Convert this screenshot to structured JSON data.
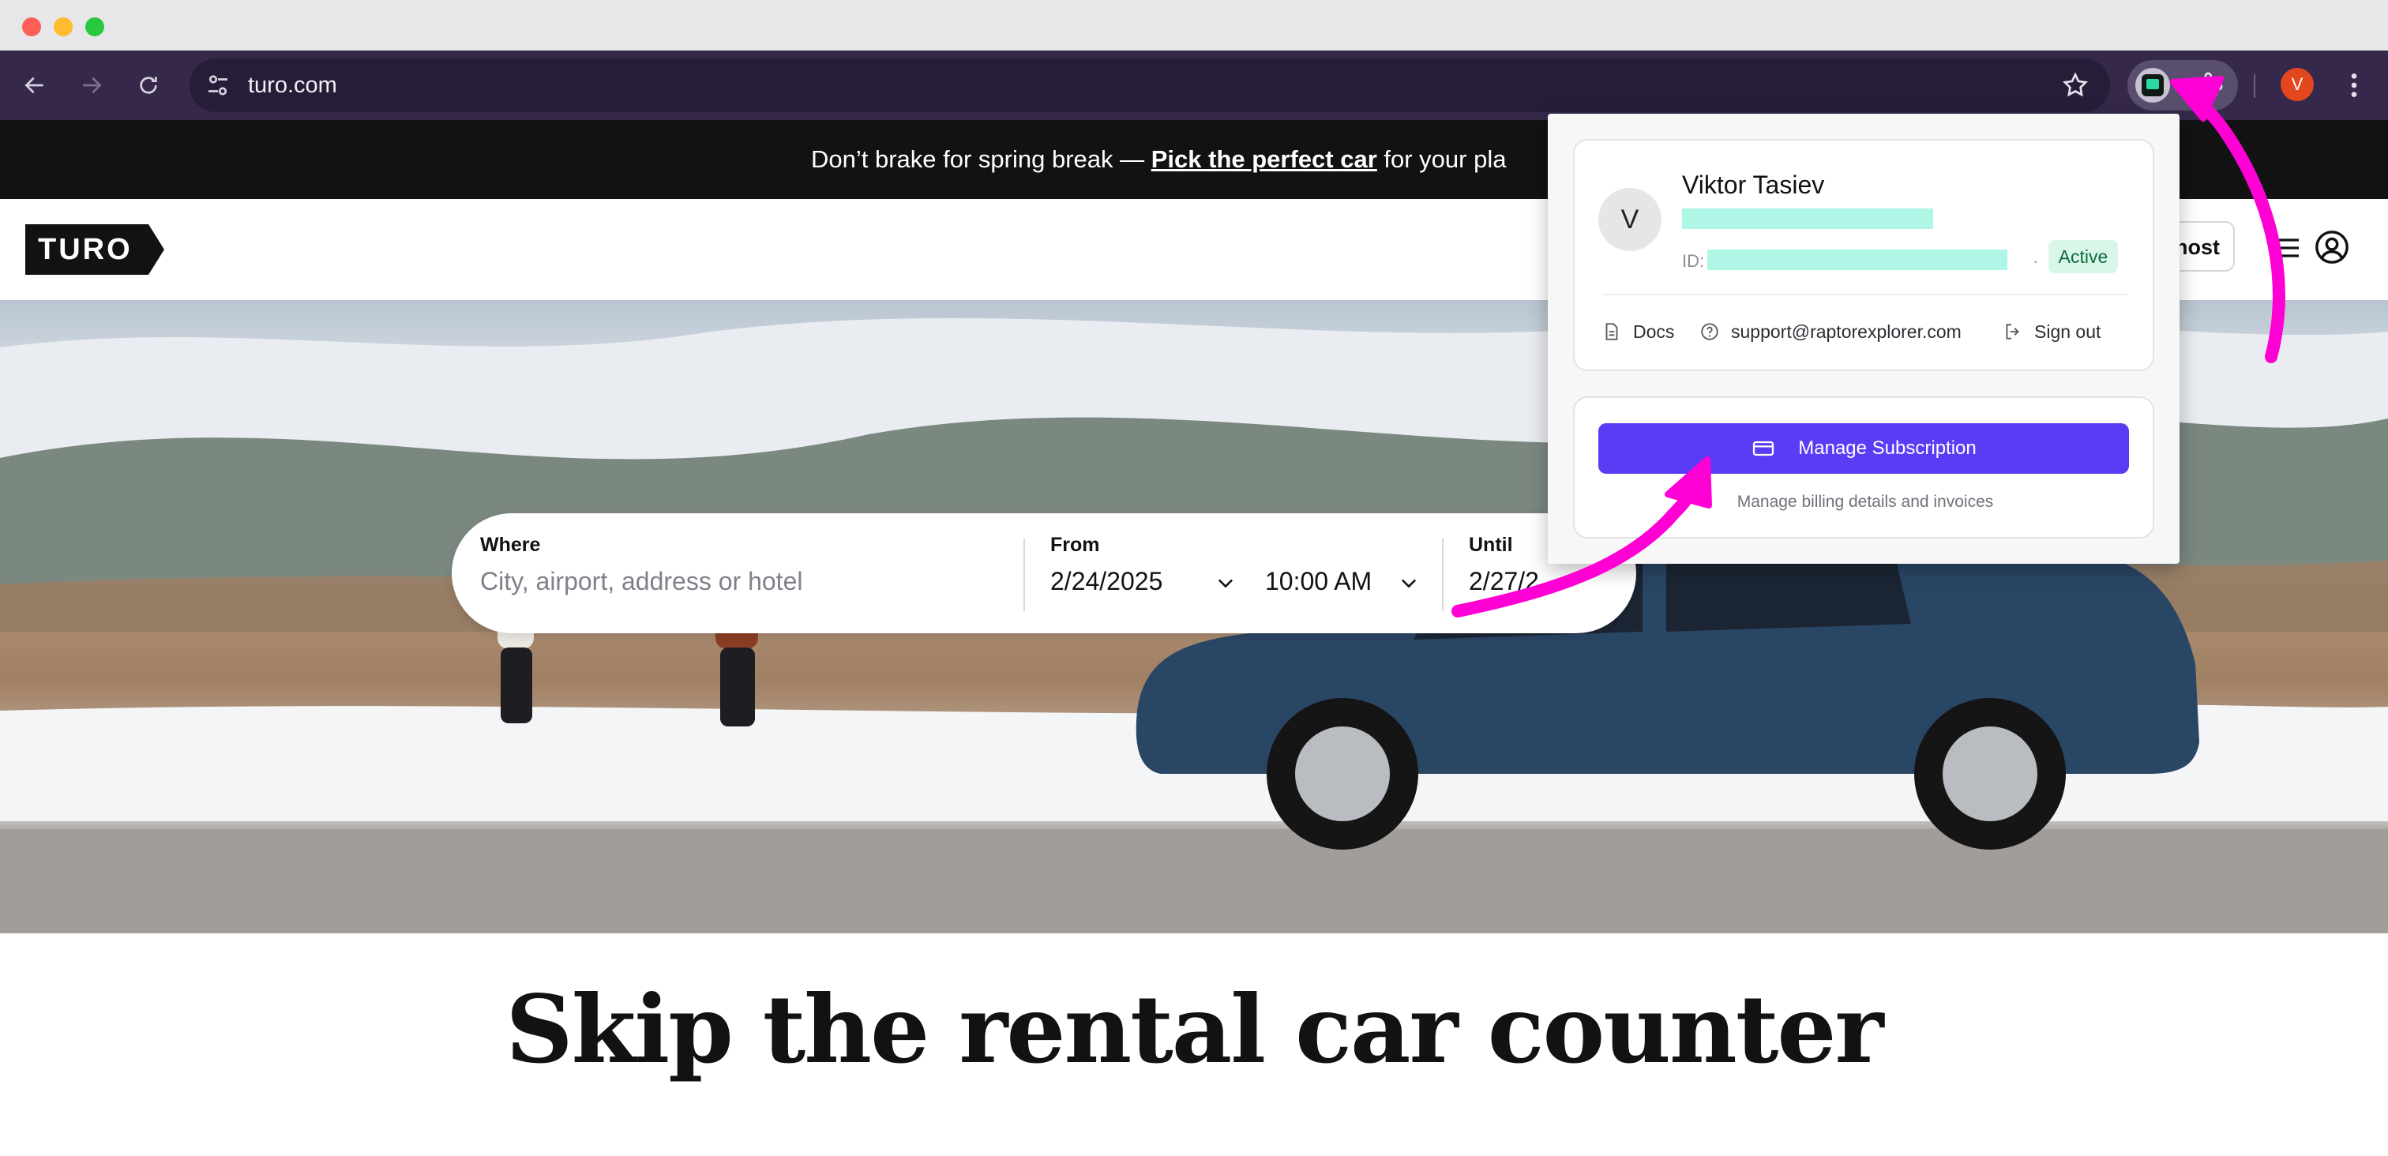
{
  "browser": {
    "url": "turo.com",
    "profile_initial": "V",
    "icons": [
      "back-icon",
      "forward-icon",
      "reload-icon",
      "site-settings-icon",
      "bookmark-star-icon",
      "extension-icon",
      "puzzle-icon",
      "kebab-menu-icon"
    ]
  },
  "banner": {
    "prefix": "Don’t brake for spring break — ",
    "link": "Pick the perfect car",
    "suffix": " for your pla"
  },
  "header": {
    "logo_text": "TURO",
    "host_label": "host"
  },
  "search": {
    "where_label": "Where",
    "where_placeholder": "City, airport, address or hotel",
    "from_label": "From",
    "from_date": "2/24/2025",
    "from_time": "10:00 AM",
    "until_label": "Until",
    "until_date": "2/27/2"
  },
  "headline": "Skip the rental car counter",
  "popup": {
    "avatar_initial": "V",
    "user_name": "Viktor Tasiev",
    "id_label": "ID:",
    "separator": "·",
    "status": "Active",
    "links": {
      "docs": "Docs",
      "support": "support@raptorexplorer.com",
      "sign_out": "Sign out"
    },
    "manage_button": "Manage Subscription",
    "manage_caption": "Manage billing details and invoices"
  },
  "colors": {
    "toolbar": "#35284a",
    "accent_button": "#5a3cf5",
    "annotation_arrow": "#ff00d4",
    "status_badge_bg": "#d8f7e8",
    "redaction": "#b0f6e6"
  }
}
